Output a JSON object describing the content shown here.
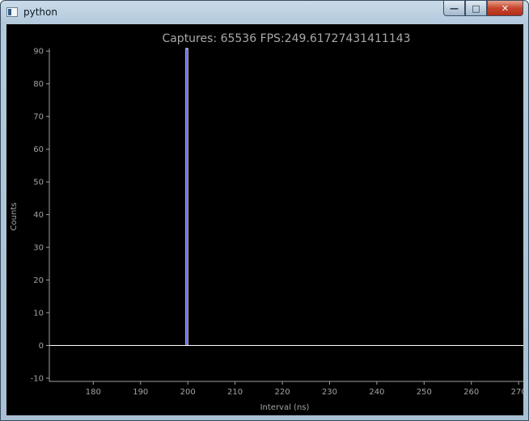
{
  "window": {
    "title": "python",
    "controls": {
      "minimize": "—",
      "maximize": "□",
      "close": "✕"
    }
  },
  "chart_data": {
    "type": "bar",
    "title": "Captures: 65536 FPS:249.61727431411143",
    "xlabel": "Interval (ns)",
    "ylabel": "Counts",
    "xlim": [
      170.7,
      271
    ],
    "ylim": [
      -11,
      90.8
    ],
    "xticks": [
      180,
      190,
      200,
      210,
      220,
      230,
      240,
      250,
      260,
      270
    ],
    "yticks": [
      -10,
      0,
      10,
      20,
      30,
      40,
      50,
      60,
      70,
      80,
      90
    ],
    "bars": [
      {
        "x0": 199.6,
        "x1": 200.0,
        "value": 90.8
      }
    ],
    "baseline": 0,
    "colors": {
      "background": "#000000",
      "bar_fill": "#1e1ee6",
      "bar_edge": "#ffffff",
      "axis": "#a0a0a0",
      "text": "#a3a3a3"
    }
  }
}
